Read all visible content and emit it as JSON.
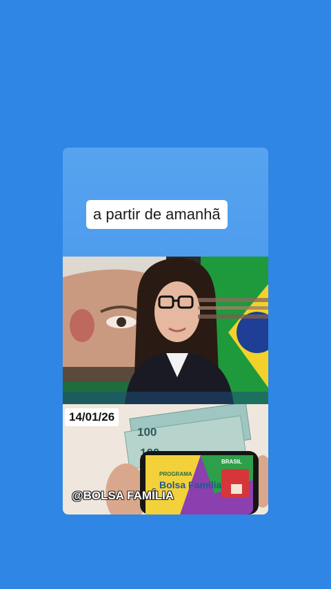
{
  "caption": "a partir de amanhã",
  "date": "14/01/26",
  "handle": "@BOLSA FAMÍLIA",
  "bottom_image": {
    "note_value": "100",
    "phone_program_label": "PROGRAMA",
    "phone_brand": "Bolsa Família",
    "phone_flag_label": "BRASIL"
  },
  "colors": {
    "background": "#2f86e4",
    "card": "#4b9bec",
    "caption_bg": "#ffffff"
  }
}
